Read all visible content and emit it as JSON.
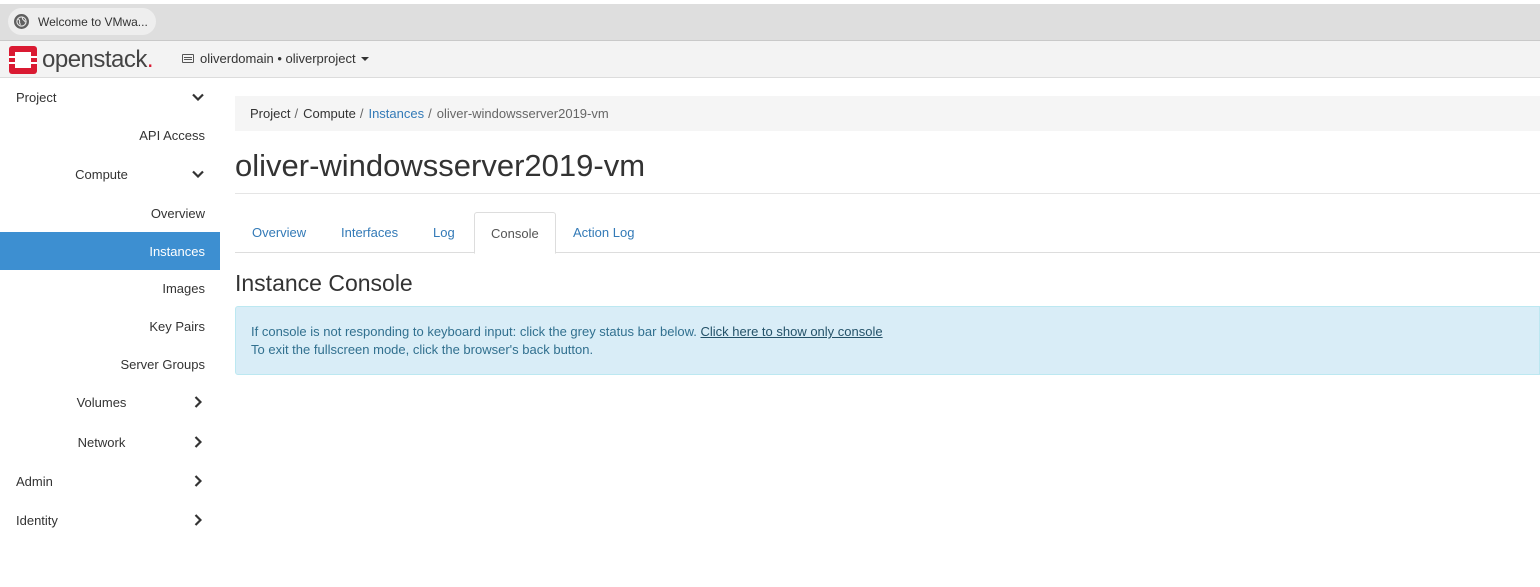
{
  "browser": {
    "tab_title": "Welcome to VMwa...",
    "tab_icon": "globe-icon"
  },
  "navbar": {
    "logo_text": "openstack",
    "logo_dot": ".",
    "project_switcher": "oliverdomain • oliverproject",
    "brand_color": "#da1a32"
  },
  "sidebar": {
    "items": [
      {
        "label": "Project",
        "level": 0,
        "icon": "chevron-down-icon"
      },
      {
        "label": "API Access",
        "level": 2
      },
      {
        "label": "Compute",
        "level": 1,
        "icon": "chevron-down-icon"
      },
      {
        "label": "Overview",
        "level": 2
      },
      {
        "label": "Instances",
        "level": 2,
        "active": true
      },
      {
        "label": "Images",
        "level": 2
      },
      {
        "label": "Key Pairs",
        "level": 2
      },
      {
        "label": "Server Groups",
        "level": 2
      },
      {
        "label": "Volumes",
        "level": 1,
        "icon": "chevron-right-icon"
      },
      {
        "label": "Network",
        "level": 1,
        "icon": "chevron-right-icon"
      },
      {
        "label": "Admin",
        "level": 0,
        "icon": "chevron-right-icon"
      },
      {
        "label": "Identity",
        "level": 0,
        "icon": "chevron-right-icon"
      }
    ],
    "active_color": "#3d8fd1"
  },
  "breadcrumb": {
    "items": [
      "Project",
      "Compute",
      "Instances",
      "oliver-windowsserver2019-vm"
    ],
    "separator": "/"
  },
  "page": {
    "title": "oliver-windowsserver2019-vm",
    "tabs": [
      "Overview",
      "Interfaces",
      "Log",
      "Console",
      "Action Log"
    ],
    "active_tab": "Console",
    "section_title": "Instance Console",
    "alert_line1": "If console is not responding to keyboard input: click the grey status bar below.",
    "alert_link": "Click here to show only console",
    "alert_line2": "To exit the fullscreen mode, click the browser's back button."
  }
}
